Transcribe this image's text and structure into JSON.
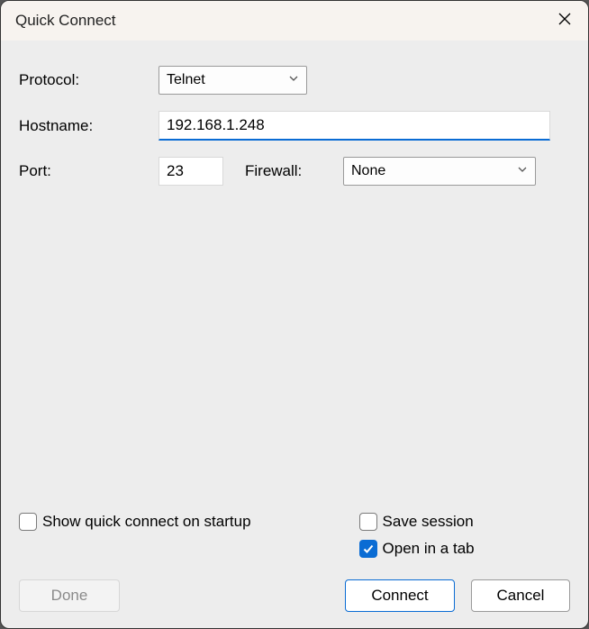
{
  "titlebar": {
    "title": "Quick Connect"
  },
  "form": {
    "protocol_label": "Protocol:",
    "protocol_value": "Telnet",
    "hostname_label": "Hostname:",
    "hostname_value": "192.168.1.248",
    "port_label": "Port:",
    "port_value": "23",
    "firewall_label": "Firewall:",
    "firewall_value": "None"
  },
  "checks": {
    "show_on_startup": "Show quick connect on startup",
    "save_session": "Save session",
    "open_in_tab": "Open in a tab"
  },
  "buttons": {
    "done": "Done",
    "connect": "Connect",
    "cancel": "Cancel"
  }
}
